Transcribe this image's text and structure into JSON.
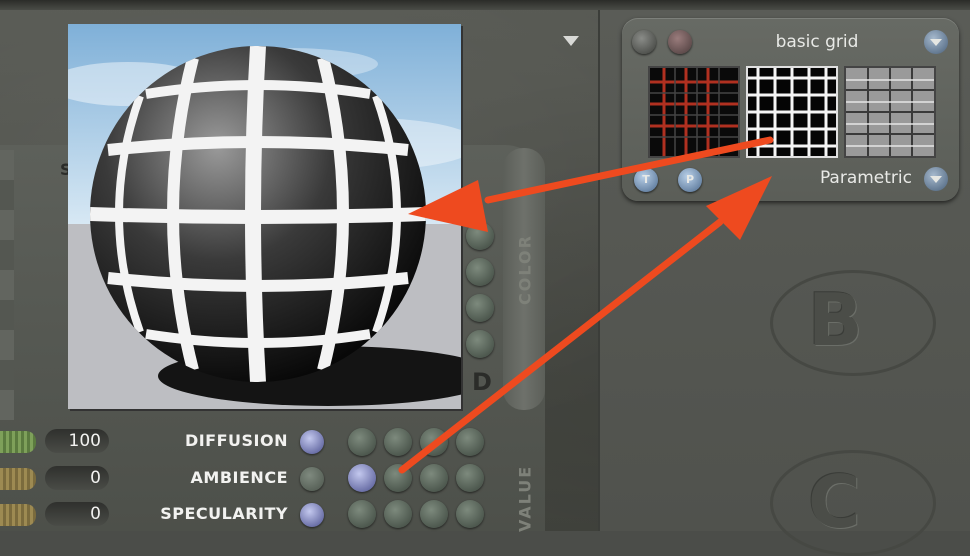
{
  "material_picker": {
    "title": "basic grid",
    "mode": "Parametric",
    "t_button": "T",
    "p_button": "P"
  },
  "left_panel": {
    "column_label_color": "COLOR",
    "column_label_value": "VALUE",
    "d_label": "D",
    "s_label": "S"
  },
  "params": [
    {
      "value": "100",
      "label": "DIFFUSION"
    },
    {
      "value": "0",
      "label": "AMBIENCE"
    },
    {
      "value": "0",
      "label": "SPECULARITY"
    }
  ],
  "panel_letters": {
    "b": "B",
    "c": "C"
  },
  "colors": {
    "annotation_arrow": "#ee4a1f",
    "grid_red": "#b03020"
  }
}
